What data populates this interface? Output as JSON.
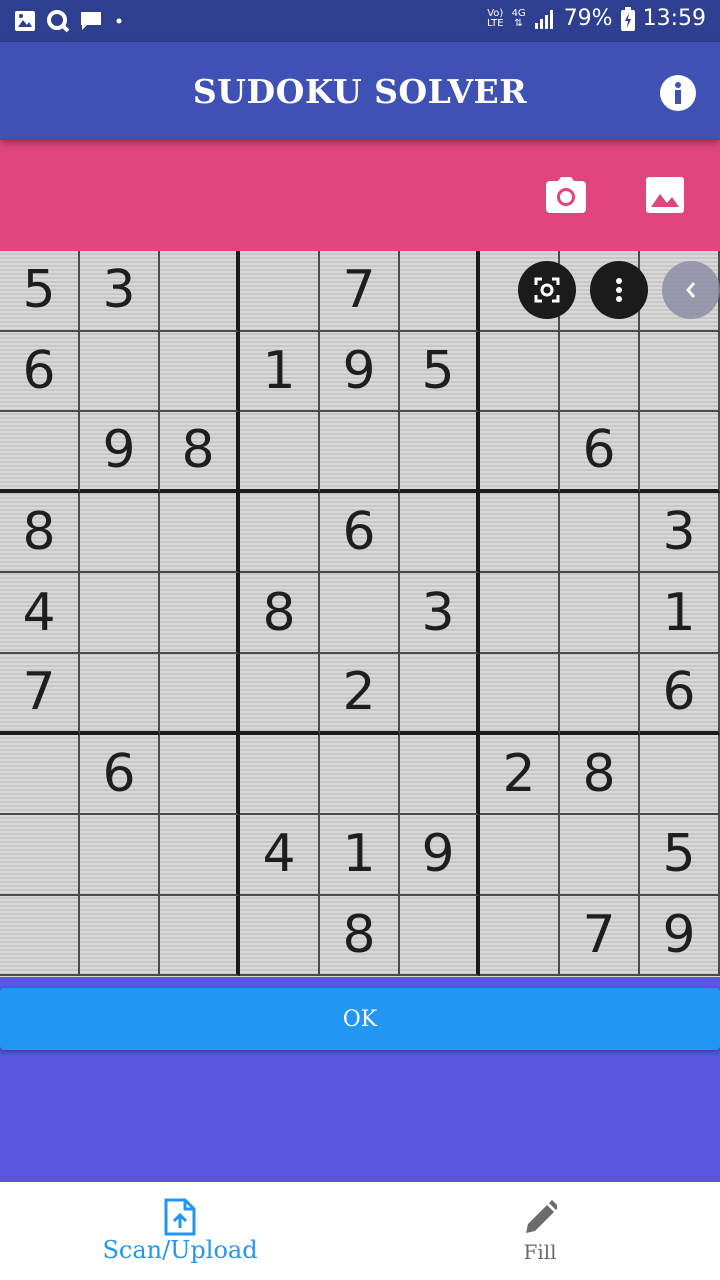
{
  "status_bar": {
    "left_icons": [
      "image-icon",
      "search-q-icon",
      "message-icon",
      "dot-icon"
    ],
    "volte_top": "Vo)",
    "volte_bottom": "LTE",
    "network": "4G",
    "battery": "79%",
    "time": "13:59"
  },
  "app_bar": {
    "title": "SUDOKU SOLVER",
    "info_icon": "info-icon"
  },
  "toolbar": {
    "camera_icon": "camera-icon",
    "gallery_icon": "image-icon"
  },
  "sudoku": {
    "rows": [
      [
        "5",
        "3",
        "",
        "",
        "7",
        "",
        "",
        "",
        ""
      ],
      [
        "6",
        "",
        "",
        "1",
        "9",
        "5",
        "",
        "",
        ""
      ],
      [
        "",
        "9",
        "8",
        "",
        "",
        "",
        "",
        "6",
        ""
      ],
      [
        "8",
        "",
        "",
        "",
        "6",
        "",
        "",
        "",
        "3"
      ],
      [
        "4",
        "",
        "",
        "8",
        "",
        "3",
        "",
        "",
        "1"
      ],
      [
        "7",
        "",
        "",
        "",
        "2",
        "",
        "",
        "",
        "6"
      ],
      [
        "",
        "6",
        "",
        "",
        "",
        "",
        "2",
        "8",
        ""
      ],
      [
        "",
        "",
        "",
        "4",
        "1",
        "9",
        "",
        "",
        "5"
      ],
      [
        "",
        "",
        "",
        "",
        "8",
        "",
        "",
        "7",
        "9"
      ]
    ]
  },
  "ok_button": {
    "label": "OK"
  },
  "bottom_nav": {
    "items": [
      {
        "label": "Scan/Upload",
        "icon": "upload-file-icon",
        "active": true
      },
      {
        "label": "Fill",
        "icon": "pencil-icon",
        "active": false
      }
    ]
  },
  "colors": {
    "status_bar": "#2f3f8f",
    "app_bar": "#3f51b5",
    "toolbar": "#e0457e",
    "accent": "#2196f3",
    "background": "#5a56e0"
  }
}
